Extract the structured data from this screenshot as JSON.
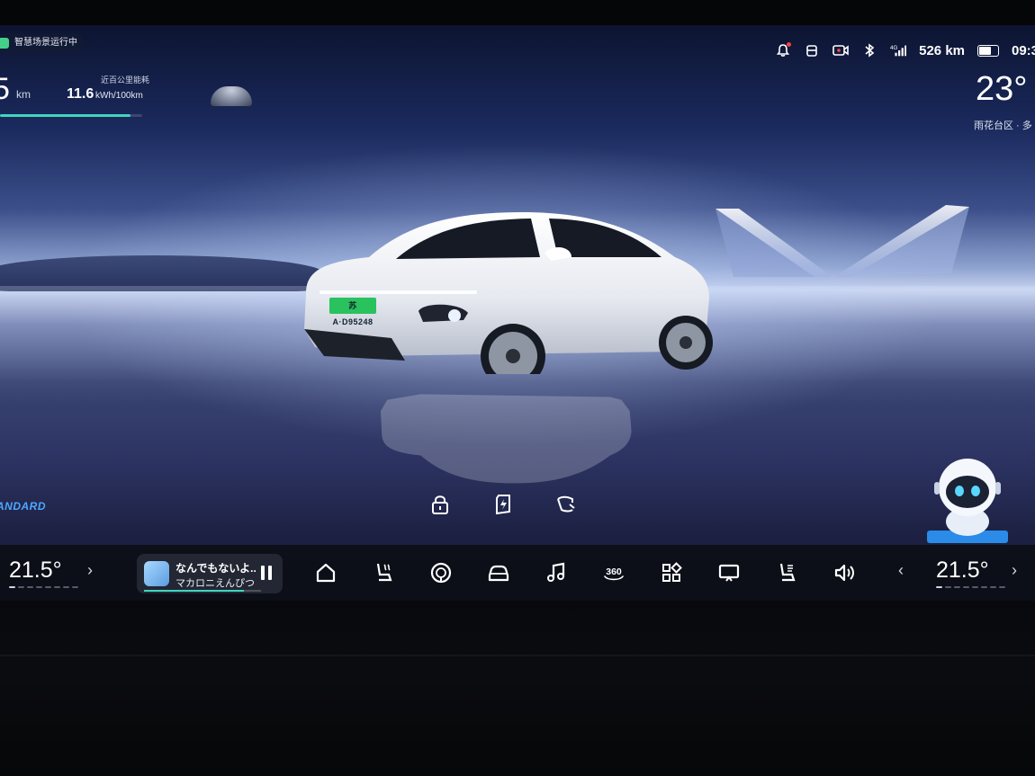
{
  "status": {
    "scene_chip": "智慧场景运行中",
    "range_value": "5",
    "range_unit": "km",
    "energy_label": "近百公里能耗",
    "energy_value": "11.6",
    "energy_unit": "kWh/100km",
    "range_bar_percent": 92,
    "network": "4G",
    "range_km": "526 km",
    "clock": "09:3",
    "battery_level_percent": 75
  },
  "weather": {
    "temperature": "23°",
    "location": "雨花台区 · 多"
  },
  "vehicle": {
    "plate": "苏A·D95248",
    "drive_mode": "ANDARD"
  },
  "quick_actions": [
    "lock-icon",
    "charge-port-icon",
    "tailgate-icon"
  ],
  "dock": {
    "temp_left": "21.5°",
    "temp_right": "21.5°",
    "temp_level_dots": 4,
    "media": {
      "title": "なんでもないよ..",
      "artist": "マカロニえんぴつ",
      "progress_percent": 85
    },
    "icons": [
      {
        "name": "home-icon",
        "label": ""
      },
      {
        "name": "seat-heat-icon",
        "label": ""
      },
      {
        "name": "steering-heat-icon",
        "label": ""
      },
      {
        "name": "car-icon",
        "label": ""
      },
      {
        "name": "music-icon",
        "label": ""
      },
      {
        "name": "camera-360-icon",
        "label": "360"
      },
      {
        "name": "apps-icon",
        "label": ""
      },
      {
        "name": "screen-icon",
        "label": ""
      },
      {
        "name": "seat-vent-icon",
        "label": ""
      },
      {
        "name": "volume-icon",
        "label": ""
      }
    ]
  },
  "colors": {
    "accent": "#3fd6c0",
    "plate": "#29c25d",
    "drive_mode": "#4da8ff"
  }
}
